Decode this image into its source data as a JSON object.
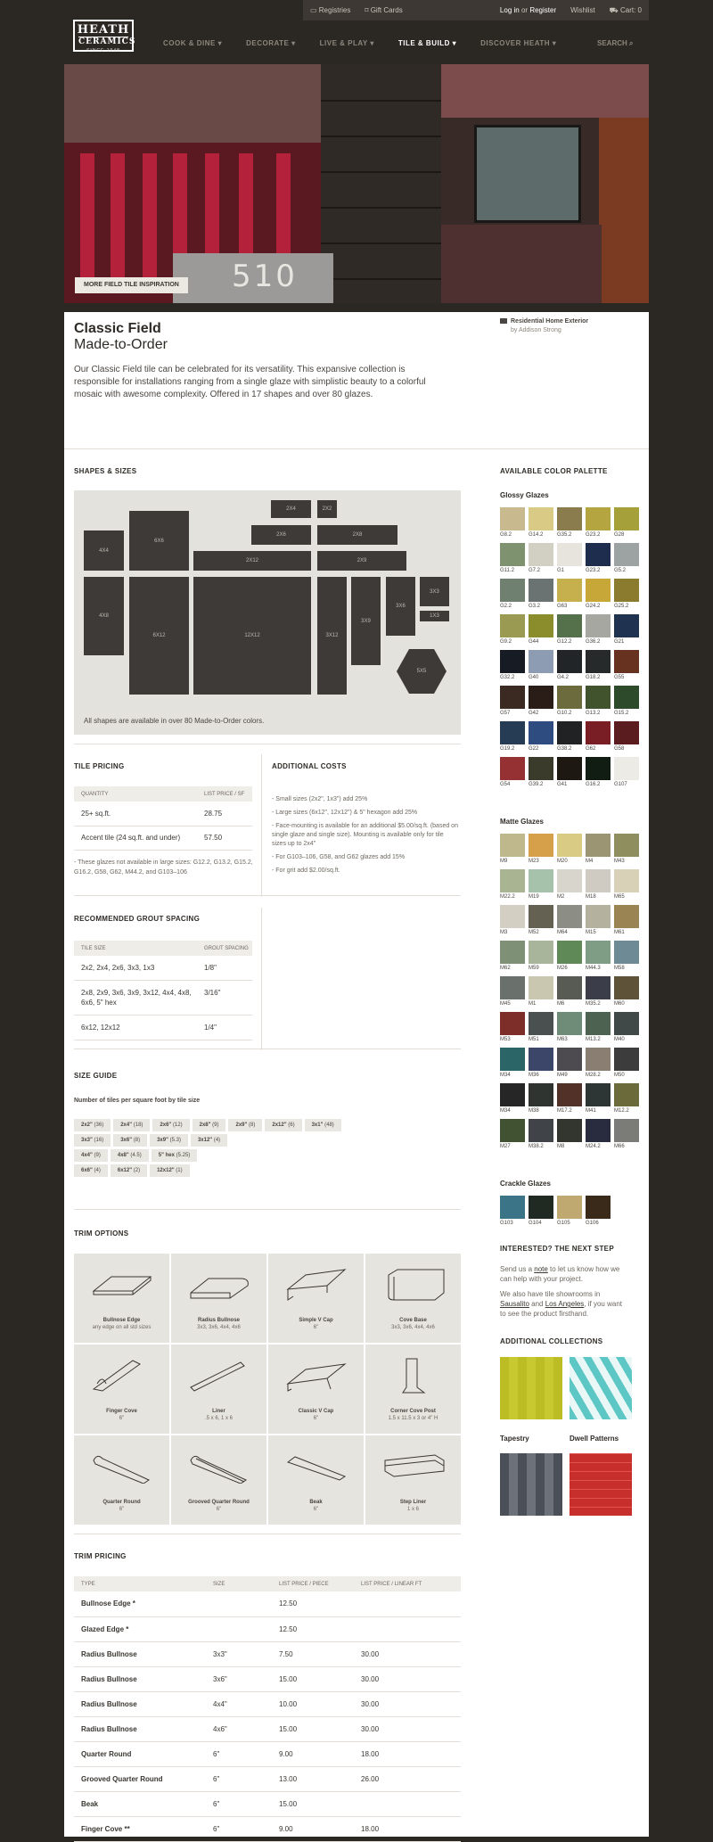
{
  "utility": {
    "registries": "Registries",
    "gift_cards": "Gift Cards",
    "login": "Log in",
    "or": "or",
    "register": "Register",
    "wishlist": "Wishlist",
    "cart": "Cart: 0"
  },
  "logo": {
    "line1": "HEATH",
    "line2": "CERAMICS",
    "since": "SINCE 1948"
  },
  "nav": [
    "COOK & DINE",
    "DECORATE",
    "LIVE & PLAY",
    "TILE & BUILD",
    "DISCOVER HEATH"
  ],
  "search": "SEARCH",
  "hero": {
    "number": "510",
    "button": "MORE FIELD TILE INSPIRATION"
  },
  "header": {
    "title": "Classic Field",
    "subtitle": "Made-to-Order",
    "intro": "Our Classic Field tile can be celebrated for its versatility. This expansive collection is responsible for installations ranging from a single glaze with simplistic beauty to a colorful mosaic with awesome complexity. Offered in 17 shapes and over 80 glazes.",
    "credit_title": "Residential Home Exterior",
    "credit_by": "by Addison Strong"
  },
  "shapes": {
    "heading": "SHAPES & SIZES",
    "labels": [
      "2X4",
      "2X2",
      "4X4",
      "6X6",
      "2X6",
      "2X8",
      "2X12",
      "2X9",
      "3X3",
      "4X8",
      "6X12",
      "12X12",
      "3X12",
      "3X9",
      "3X6",
      "1X3",
      "5X5"
    ],
    "note": "All shapes are available in over 80 Made-to-Order colors."
  },
  "pricing": {
    "heading": "TILE PRICING",
    "col1": "QUANTITY",
    "col2": "LIST PRICE / SF",
    "rows": [
      [
        "25+ sq.ft.",
        "28.75"
      ],
      [
        "Accent tile (24 sq.ft. and under)",
        "57.50"
      ]
    ],
    "footnote": "- These glazes not available in large sizes: G12.2, G13.2, G15.2, G16.2, G58, G62, M44.2, and G103–106"
  },
  "costs": {
    "heading": "ADDITIONAL COSTS",
    "items": [
      "- Small sizes (2x2\", 1x3\") add 25%",
      "- Large sizes (6x12\", 12x12\") & 5\" hexagon add 25%",
      "- Face-mounting is available for an additional $5.00/sq.ft. (based on single glaze and single size). Mounting is available only for tile sizes up to 2x4\"",
      "- For G103–106, G58, and G62 glazes add 15%",
      "- For grit add $2.00/sq.ft."
    ]
  },
  "grout": {
    "heading": "RECOMMENDED GROUT SPACING",
    "col1": "TILE SIZE",
    "col2": "GROUT SPACING",
    "rows": [
      [
        "2x2, 2x4, 2x6, 3x3, 1x3",
        "1/8\""
      ],
      [
        "2x8, 2x9, 3x6, 3x9, 3x12, 4x4, 4x8, 6x6, 5\" hex",
        "3/16\""
      ],
      [
        "6x12, 12x12",
        "1/4\""
      ]
    ]
  },
  "size_guide": {
    "heading": "SIZE GUIDE",
    "subheading": "Number of tiles per square foot by tile size",
    "chips": [
      [
        "2x2\"",
        "(36)"
      ],
      [
        "2x4\"",
        "(18)"
      ],
      [
        "2x6\"",
        "(12)"
      ],
      [
        "2x8\"",
        "(9)"
      ],
      [
        "2x9\"",
        "(8)"
      ],
      [
        "2x12\"",
        "(6)"
      ],
      [
        "3x1\"",
        "(48)"
      ],
      [
        "3x3\"",
        "(16)"
      ],
      [
        "3x6\"",
        "(8)"
      ],
      [
        "3x9\"",
        "(5.3)"
      ],
      [
        "3x12\"",
        "(4)"
      ],
      [
        "4x4\"",
        "(9)"
      ],
      [
        "4x8\"",
        "(4.5)"
      ],
      [
        "5\" hex",
        "(5.25)"
      ],
      [
        "6x6\"",
        "(4)"
      ],
      [
        "6x12\"",
        "(2)"
      ],
      [
        "12x12\"",
        "(1)"
      ]
    ]
  },
  "trim": {
    "heading": "TRIM OPTIONS",
    "tiles": [
      [
        "Bullnose Edge",
        "any edge on all std sizes"
      ],
      [
        "Radius Bullnose",
        "3x3, 3x6, 4x4, 4x6"
      ],
      [
        "Simple V Cap",
        "6\""
      ],
      [
        "Cove Base",
        "3x3, 3x6, 4x4, 4x6"
      ],
      [
        "Finger Cove",
        "6\""
      ],
      [
        "Liner",
        ".5 x 6, 1 x 6"
      ],
      [
        "Classic V Cap",
        "6\""
      ],
      [
        "Corner Cove Post",
        "1.5 x 11.5 x 3 or 4\" H"
      ],
      [
        "Quarter Round",
        "6\""
      ],
      [
        "Grooved Quarter Round",
        "6\""
      ],
      [
        "Beak",
        "6\""
      ],
      [
        "Step Liner",
        "1 x 6"
      ]
    ]
  },
  "trim_pricing": {
    "heading": "TRIM PRICING",
    "cols": [
      "TYPE",
      "SIZE",
      "LIST PRICE / PIECE",
      "LIST PRICE / LINEAR FT"
    ],
    "rows": [
      [
        "Bullnose Edge *",
        "",
        "12.50",
        ""
      ],
      [
        "Glazed Edge *",
        "",
        "12.50",
        ""
      ],
      [
        "Radius Bullnose",
        "3x3\"",
        "7.50",
        "30.00"
      ],
      [
        "Radius Bullnose",
        "3x6\"",
        "15.00",
        "30.00"
      ],
      [
        "Radius Bullnose",
        "4x4\"",
        "10.00",
        "30.00"
      ],
      [
        "Radius Bullnose",
        "4x6\"",
        "15.00",
        "30.00"
      ],
      [
        "Quarter Round",
        "6\"",
        "9.00",
        "18.00"
      ],
      [
        "Grooved Quarter Round",
        "6\"",
        "13.00",
        "26.00"
      ],
      [
        "Beak",
        "6\"",
        "15.00",
        ""
      ],
      [
        "Finger Cove **",
        "6\"",
        "9.00",
        "18.00"
      ]
    ]
  },
  "palette": {
    "heading": "AVAILABLE COLOR PALETTE",
    "glossy_title": "Glossy Glazes",
    "glossy": [
      [
        "G8.2",
        "#c9b98e"
      ],
      [
        "G14.2",
        "#d9ca85"
      ],
      [
        "G35.2",
        "#8a7c4c"
      ],
      [
        "G23.2",
        "#b4a540"
      ],
      [
        "G28",
        "#a5a03a"
      ],
      [
        "G11.2",
        "#7f9270"
      ],
      [
        "G7.2",
        "#d2d0c2"
      ],
      [
        "G1",
        "#e6e4dc"
      ],
      [
        "G23.2",
        "#1e2d4e"
      ],
      [
        "G5.2",
        "#9da2a3"
      ],
      [
        "G2.2",
        "#6f7f70"
      ],
      [
        "G3.2",
        "#6a7371"
      ],
      [
        "G63",
        "#c6b04d"
      ],
      [
        "G24.2",
        "#c8a739"
      ],
      [
        "G25.2",
        "#8b7b2e"
      ],
      [
        "G9.2",
        "#9a9a52"
      ],
      [
        "G44",
        "#8b8d2d"
      ],
      [
        "G12.2",
        "#55714b"
      ],
      [
        "G36.2",
        "#a6a7a0"
      ],
      [
        "G21",
        "#1f3350"
      ],
      [
        "G32.2",
        "#171b24"
      ],
      [
        "G40",
        "#8d9cb3"
      ],
      [
        "G4.2",
        "#222527"
      ],
      [
        "G18.2",
        "#272a2b"
      ],
      [
        "G55",
        "#67321f"
      ],
      [
        "G57",
        "#3a2a22"
      ],
      [
        "G42",
        "#2a1c17"
      ],
      [
        "G10.2",
        "#6b6b3e"
      ],
      [
        "G13.2",
        "#41532d"
      ],
      [
        "G15.2",
        "#2d4a2a"
      ],
      [
        "G19.2",
        "#263c55"
      ],
      [
        "G22",
        "#2e4c7f"
      ],
      [
        "G38.2",
        "#212224"
      ],
      [
        "G62",
        "#7a1e25"
      ],
      [
        "G58",
        "#5b1c20"
      ],
      [
        "G54",
        "#953033"
      ],
      [
        "G39.2",
        "#3b3b2c"
      ],
      [
        "G41",
        "#1d1812"
      ],
      [
        "G16.2",
        "#111c12"
      ],
      [
        "G107",
        "#ecebe5"
      ]
    ],
    "matte_title": "Matte Glazes",
    "matte": [
      [
        "M9",
        "#bfb88d"
      ],
      [
        "M23",
        "#d6a04a"
      ],
      [
        "M20",
        "#d9cb84"
      ],
      [
        "M4",
        "#9b9574"
      ],
      [
        "M43",
        "#8e8e5f"
      ],
      [
        "M22.2",
        "#a8b492"
      ],
      [
        "M19",
        "#a7c2ab"
      ],
      [
        "M2",
        "#d8d6cc"
      ],
      [
        "M18",
        "#cfcbc2"
      ],
      [
        "M65",
        "#d8d0b7"
      ],
      [
        "M3",
        "#d3cfc2"
      ],
      [
        "M52",
        "#646152"
      ],
      [
        "M64",
        "#8c8e86"
      ],
      [
        "M15",
        "#b4b29e"
      ],
      [
        "M61",
        "#9a8453"
      ],
      [
        "M62",
        "#7e9075"
      ],
      [
        "M59",
        "#a9b59b"
      ],
      [
        "M26",
        "#5f8a58"
      ],
      [
        "M44.3",
        "#7f9d84"
      ],
      [
        "M58",
        "#6e8a95"
      ],
      [
        "M45",
        "#6a706b"
      ],
      [
        "M1",
        "#c9c7b0"
      ],
      [
        "M6",
        "#585a54"
      ],
      [
        "M35.2",
        "#3b3e49"
      ],
      [
        "M60",
        "#5e5238"
      ],
      [
        "M53",
        "#7d2e28"
      ],
      [
        "M51",
        "#4a5050"
      ],
      [
        "M63",
        "#6e8c78"
      ],
      [
        "M13.2",
        "#4e6252"
      ],
      [
        "M40",
        "#414848"
      ],
      [
        "M34",
        "#2b6568"
      ],
      [
        "M36",
        "#3b4669"
      ],
      [
        "M49",
        "#4d4a50"
      ],
      [
        "M28.2",
        "#8a7e72"
      ],
      [
        "M50",
        "#3c3c3c"
      ],
      [
        "M34",
        "#262626"
      ],
      [
        "M38",
        "#2f3430"
      ],
      [
        "M17.2",
        "#513128"
      ],
      [
        "M41",
        "#2d3535"
      ],
      [
        "M12.2",
        "#6b6a3b"
      ],
      [
        "M27",
        "#415233"
      ],
      [
        "M38.2",
        "#404448"
      ],
      [
        "M8",
        "#33352f"
      ],
      [
        "M24.2",
        "#282c3e"
      ],
      [
        "M66",
        "#7b7c78"
      ]
    ],
    "crackle_title": "Crackle Glazes",
    "crackle": [
      [
        "G103",
        "#3a7486"
      ],
      [
        "G104",
        "#202a22"
      ],
      [
        "G105",
        "#bfa971"
      ],
      [
        "G106",
        "#3a2a1a"
      ]
    ]
  },
  "next_step": {
    "heading": "INTERESTED? THE NEXT STEP",
    "p1_a": "Send us a ",
    "p1_link": "note",
    "p1_b": " to let us know how we can help with your project.",
    "p2_a": "We also have tile showrooms in ",
    "p2_link1": "Sausalito",
    "p2_and": " and ",
    "p2_link2": "Los Angeles",
    "p2_b": ", if you want to see the product firsthand."
  },
  "collections": {
    "heading": "ADDITIONAL COLLECTIONS",
    "items": [
      "Tapestry",
      "Dwell Patterns"
    ]
  }
}
